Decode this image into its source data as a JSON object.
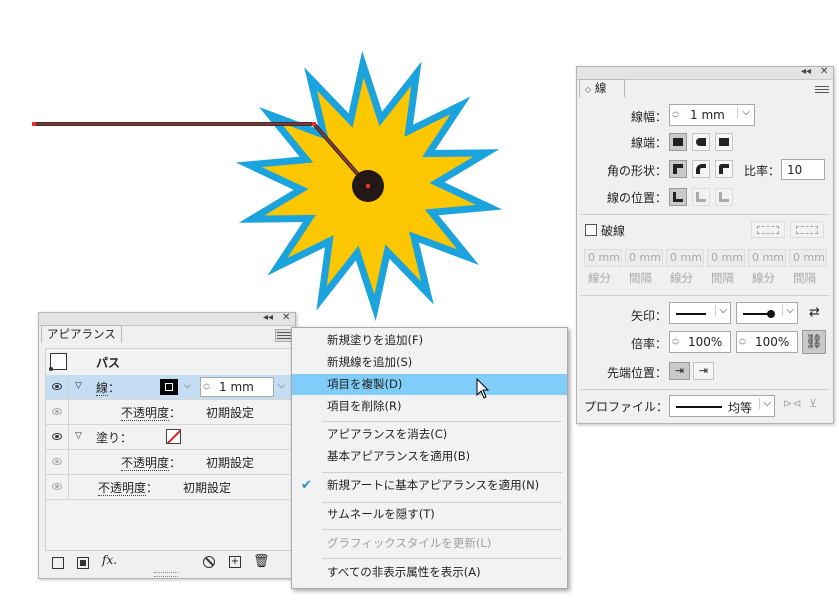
{
  "appearance_panel": {
    "tab": "アピアランス",
    "object_type": "パス",
    "rows": [
      {
        "label": "線",
        "stroke_weight": "1 mm"
      },
      {
        "label": "不透明度",
        "value": "初期設定"
      },
      {
        "label": "塗り"
      },
      {
        "label": "不透明度",
        "value": "初期設定"
      },
      {
        "label": "不透明度",
        "value": "初期設定"
      }
    ],
    "colon": "：",
    "footer_fx": "fx."
  },
  "context_menu": {
    "items": [
      {
        "label": "新規塗りを追加(F)"
      },
      {
        "label": "新規線を追加(S)"
      },
      {
        "label": "項目を複製(D)",
        "highlighted": true
      },
      {
        "label": "項目を削除(R)"
      },
      {
        "label": "アピアランスを消去(C)"
      },
      {
        "label": "基本アピアランスを適用(B)"
      },
      {
        "label": "新規アートに基本アピアランスを適用(N)",
        "checked": true
      },
      {
        "label": "サムネールを隠す(T)"
      },
      {
        "label": "グラフィックスタイルを更新(L)",
        "disabled": true
      },
      {
        "label": "すべての非表示属性を表示(A)"
      }
    ]
  },
  "stroke_panel": {
    "tab": "線",
    "weight_label": "線幅：",
    "weight_value": "1 mm",
    "cap_label": "線端：",
    "corner_label": "角の形状：",
    "ratio_label": "比率：",
    "ratio_value": "10",
    "align_label": "線の位置：",
    "dashed_label": "破線",
    "dash_value": "0 mm",
    "dash_field_labels": [
      "線分",
      "間隔",
      "線分",
      "間隔",
      "線分",
      "間隔"
    ],
    "arrow_label": "矢印：",
    "scale_label": "倍率：",
    "scale_start": "100%",
    "scale_end": "100%",
    "tip_label": "先端位置：",
    "profile_label": "プロファイル：",
    "profile_value": "均等"
  },
  "colors": {
    "star_fill": "#fdc700",
    "star_stroke": "#1aa3dd",
    "menu_highlight": "#7fcdf8",
    "path_red": "#e03030"
  }
}
